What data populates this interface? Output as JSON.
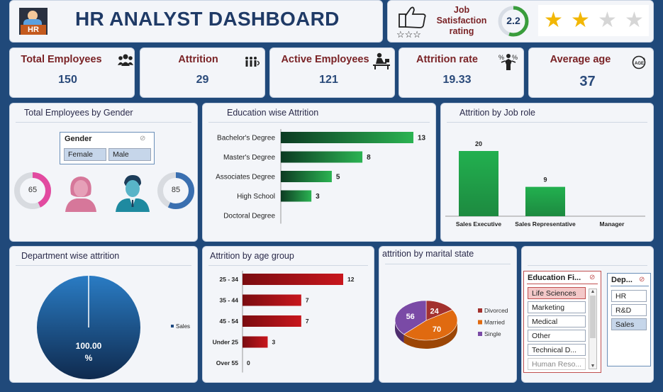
{
  "header": {
    "title": "HR ANALYST DASHBOARD",
    "logo_text": "HR",
    "job_satisfaction_label": [
      "Job",
      "Satisfaction",
      "rating"
    ],
    "job_satisfaction_value": "2.2",
    "job_satisfaction_fraction": 0.55,
    "star_rating": {
      "filled": 2,
      "total": 4
    }
  },
  "kpis": [
    {
      "label": "Total Employees",
      "value": "150",
      "icon": "group-icon"
    },
    {
      "label": "Attrition",
      "value": "29",
      "icon": "people-leaving-icon"
    },
    {
      "label": "Active Employees",
      "value": "121",
      "icon": "worker-at-desk-icon"
    },
    {
      "label": "Attrition rate",
      "value": "19.33",
      "icon": "person-percent-icon"
    },
    {
      "label": "Average age",
      "value": "37",
      "icon": "age-icon"
    }
  ],
  "gender_panel": {
    "title": "Total Employees by Gender",
    "slicer_title": "Gender",
    "options": [
      "Female",
      "Male"
    ],
    "female_value": "65",
    "male_value": "85",
    "female_fraction": 0.43,
    "male_fraction": 0.57,
    "female_color": "#e24aa0",
    "male_color": "#3a6fb0"
  },
  "education_attrition": {
    "title": "Education wise Attrition"
  },
  "jobrole_attrition": {
    "title": "Attrition by Job role"
  },
  "department_attrition": {
    "title": "Department  wise attrition",
    "legend": [
      "Sales"
    ]
  },
  "age_attrition": {
    "title": "Attrition by age group"
  },
  "marital_attrition": {
    "title": "attrition by marital state",
    "legend": [
      "Divorced",
      "Married",
      "Single"
    ]
  },
  "slicers": {
    "education_field": {
      "title": "Education Fi...",
      "items": [
        "Life Sciences",
        "Marketing",
        "Medical",
        "Other",
        "Technical D...",
        "Human Reso..."
      ],
      "selected": "Life Sciences"
    },
    "department": {
      "title": "Dep...",
      "items": [
        "HR",
        "R&D",
        "Sales"
      ],
      "selected": "Sales"
    }
  },
  "chart_data": [
    {
      "type": "bar",
      "orientation": "horizontal",
      "title": "Education wise Attrition",
      "categories": [
        "Bachelor's Degree",
        "Master's Degree",
        "Associates Degree",
        "High School",
        "Doctoral Degree"
      ],
      "values": [
        13,
        8,
        5,
        3,
        0
      ],
      "data_labels": [
        "13",
        "8",
        "5",
        "3",
        ""
      ],
      "color": "#2bb352"
    },
    {
      "type": "bar",
      "orientation": "vertical",
      "title": "Attrition by Job role",
      "categories": [
        "Sales Executive",
        "Sales Representative",
        "Manager"
      ],
      "values": [
        20,
        9,
        0
      ],
      "data_labels": [
        "20",
        "9",
        ""
      ],
      "color": "#22b04f"
    },
    {
      "type": "pie",
      "title": "Department  wise attrition",
      "categories": [
        "Sales"
      ],
      "values": [
        100.0
      ],
      "data_labels": [
        "100.00",
        "%"
      ],
      "legend": "right",
      "color": "#1e4a82"
    },
    {
      "type": "bar",
      "orientation": "horizontal",
      "title": "Attrition by age group",
      "categories": [
        "25 - 34",
        "35 - 44",
        "45 - 54",
        "Under 25",
        "Over 55"
      ],
      "values": [
        12,
        7,
        7,
        3,
        0
      ],
      "data_labels": [
        "12",
        "7",
        "7",
        "3",
        "0"
      ],
      "color": "#c8161d"
    },
    {
      "type": "pie",
      "title": "attrition by marital state",
      "categories": [
        "Divorced",
        "Married",
        "Single"
      ],
      "values": [
        24,
        70,
        56
      ],
      "data_labels": [
        "24",
        "70",
        "56"
      ],
      "colors": [
        "#a3312e",
        "#e06a10",
        "#7a4aa6"
      ],
      "legend": "right"
    }
  ]
}
